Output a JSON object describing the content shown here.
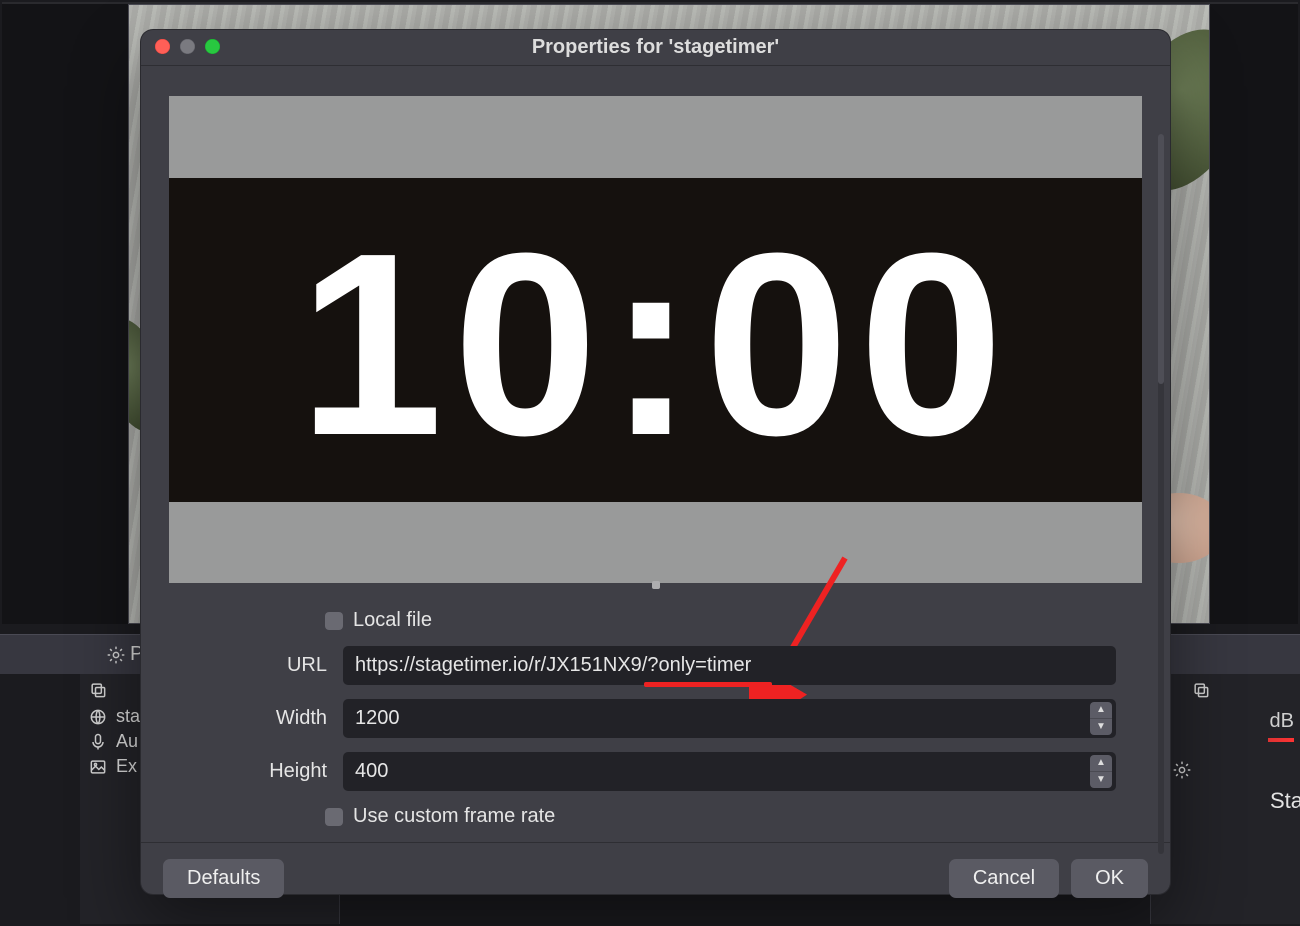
{
  "dialog": {
    "title": "Properties for 'stagetimer'",
    "preview_timer": "10:00",
    "localfile_label": "Local file",
    "url_label": "URL",
    "url_value": "https://stagetimer.io/r/JX151NX9/?only=timer",
    "width_label": "Width",
    "width_value": "1200",
    "height_label": "Height",
    "height_value": "400",
    "framerate_label": "Use custom frame rate",
    "buttons": {
      "defaults": "Defaults",
      "cancel": "Cancel",
      "ok": "OK"
    }
  },
  "host": {
    "bottom_bar_letter": "P",
    "sources": [
      {
        "icon": "globe",
        "label": "sta"
      },
      {
        "icon": "mic",
        "label": "Au"
      },
      {
        "icon": "image",
        "label": "Ex"
      }
    ],
    "right_db": "dB",
    "right_sta": "Sta"
  },
  "annotation": {
    "color": "#e22"
  }
}
